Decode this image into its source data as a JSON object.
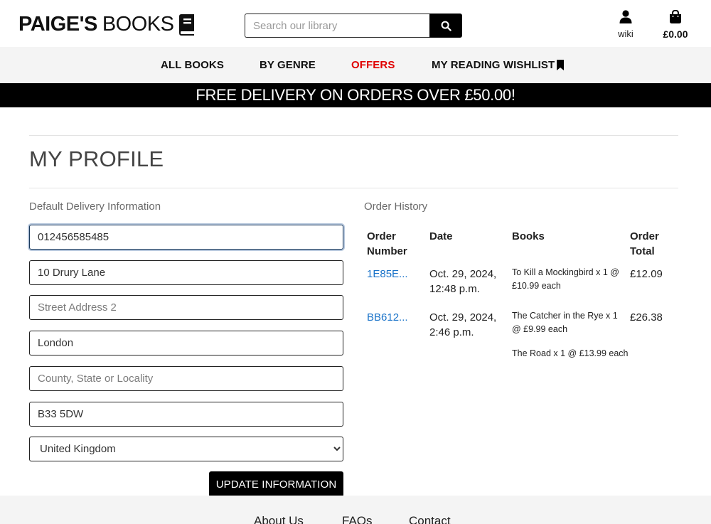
{
  "brand": {
    "bold": "PAIGE'S",
    "light": "BOOKS",
    "icon": "book-icon"
  },
  "search": {
    "placeholder": "Search our library",
    "icon": "search-icon"
  },
  "account": {
    "label": "wiki",
    "icon": "user-icon"
  },
  "bag": {
    "total": "£0.00",
    "icon": "shopping-bag-icon"
  },
  "nav": {
    "items": [
      {
        "label": "ALL BOOKS"
      },
      {
        "label": "BY GENRE"
      },
      {
        "label": "OFFERS",
        "color": "#e00000"
      },
      {
        "label": "MY READING WISHLIST",
        "icon": "bookmark-icon"
      }
    ]
  },
  "banner": {
    "text": "FREE DELIVERY ON ORDERS OVER £50.00!"
  },
  "page": {
    "title": "MY PROFILE"
  },
  "delivery": {
    "heading": "Default Delivery Information",
    "phone": "012456585485",
    "street1": "10 Drury Lane",
    "street2_placeholder": "Street Address 2",
    "town": "London",
    "county_placeholder": "County, State or Locality",
    "postcode": "B33 5DW",
    "country": "United Kingdom",
    "update_label": "UPDATE INFORMATION"
  },
  "orders": {
    "heading": "Order History",
    "headers": {
      "number": "Order\nNumber",
      "date": "Date",
      "books": "Books",
      "total": "Order\nTotal"
    },
    "rows": [
      {
        "number": "1E85E...",
        "date": "Oct. 29, 2024, 12:48 p.m.",
        "books": [
          "To Kill a Mockingbird x 1 @ £10.99 each"
        ],
        "total": "£12.09"
      },
      {
        "number": "BB612...",
        "date": "Oct. 29, 2024, 2:46 p.m.",
        "books": [
          "The Catcher in the Rye x 1 @ £9.99 each",
          "The Road x 1 @ £13.99 each"
        ],
        "total": "£26.38"
      }
    ]
  },
  "footer": {
    "links": [
      "About Us",
      "FAQs",
      "Contact"
    ]
  },
  "colors": {
    "accent": "#e00000",
    "link": "#1a73c9",
    "banner_bg": "#000000",
    "nav_bg": "#f4f4f4"
  }
}
